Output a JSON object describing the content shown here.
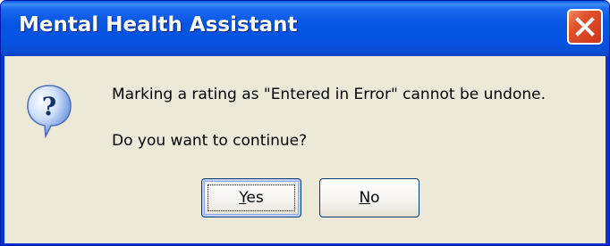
{
  "window": {
    "title": "Mental Health Assistant",
    "close_icon": "close-icon"
  },
  "message": {
    "icon": "question-icon",
    "line1": "Marking a rating as \"Entered in Error\" cannot be undone.",
    "line2": "Do you want to continue?"
  },
  "buttons": {
    "yes": {
      "mnemonic": "Y",
      "rest": "es"
    },
    "no": {
      "mnemonic": "N",
      "rest": "o"
    },
    "default": "yes"
  },
  "colors": {
    "titlebar": "#0553e1",
    "client_bg": "#ece9d8",
    "close_button": "#e0502a",
    "title_text": "#ffffff"
  }
}
